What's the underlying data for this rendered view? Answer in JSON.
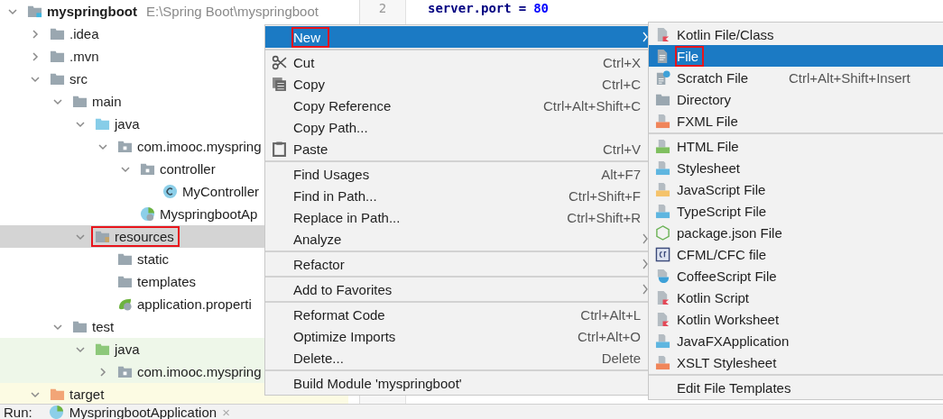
{
  "project_tree": [
    {
      "label": "myspringboot",
      "path": "E:\\Spring Boot\\myspringboot",
      "kind": "module",
      "expanded": true,
      "selected": false,
      "boxed": false,
      "children": [
        {
          "label": ".idea",
          "kind": "folder",
          "expanded": false,
          "selected": false,
          "boxed": false
        },
        {
          "label": ".mvn",
          "kind": "folder",
          "expanded": false,
          "selected": false,
          "boxed": false
        },
        {
          "label": "src",
          "kind": "folder",
          "expanded": true,
          "selected": false,
          "boxed": false,
          "children": [
            {
              "label": "main",
              "kind": "folder",
              "expanded": true,
              "selected": false,
              "boxed": false,
              "children": [
                {
                  "label": "java",
                  "kind": "source",
                  "expanded": true,
                  "selected": false,
                  "boxed": false,
                  "children": [
                    {
                      "label": "com.imooc.myspring",
                      "kind": "package",
                      "expanded": true,
                      "selected": false,
                      "boxed": false,
                      "children": [
                        {
                          "label": "controller",
                          "kind": "package",
                          "expanded": true,
                          "selected": false,
                          "boxed": false,
                          "children": [
                            {
                              "label": "MyController",
                              "kind": "class",
                              "selected": false,
                              "boxed": false
                            }
                          ]
                        },
                        {
                          "label": "MyspringbootAp",
                          "kind": "spring-class",
                          "selected": false,
                          "boxed": false
                        }
                      ]
                    }
                  ]
                },
                {
                  "label": "resources",
                  "kind": "resources",
                  "expanded": true,
                  "selected": true,
                  "boxed": true,
                  "children": [
                    {
                      "label": "static",
                      "kind": "folder",
                      "selected": false,
                      "boxed": false
                    },
                    {
                      "label": "templates",
                      "kind": "folder",
                      "selected": false,
                      "boxed": false
                    },
                    {
                      "label": "application.properti",
                      "kind": "spring-config",
                      "selected": false,
                      "boxed": false
                    }
                  ]
                }
              ]
            },
            {
              "label": "test",
              "kind": "folder",
              "expanded": true,
              "selected": false,
              "boxed": false,
              "children": [
                {
                  "label": "java",
                  "kind": "test-source",
                  "expanded": true,
                  "selected": false,
                  "boxed": false,
                  "color": "#eef7e9",
                  "children": [
                    {
                      "label": "com.imooc.myspring",
                      "kind": "package",
                      "expanded": false,
                      "selected": false,
                      "boxed": false,
                      "color": "#eef7e9"
                    }
                  ]
                }
              ]
            }
          ]
        },
        {
          "label": "target",
          "kind": "excluded",
          "expanded": true,
          "selected": false,
          "boxed": false,
          "color": "#fcfbe3"
        }
      ]
    }
  ],
  "editor": {
    "line_number": "2",
    "code": [
      {
        "kind": "key",
        "text": "server.port"
      },
      {
        "kind": "op",
        "text": "="
      },
      {
        "kind": "number",
        "text": "80"
      }
    ]
  },
  "run_bar": {
    "label": "Run:",
    "tab": "MyspringbootApplication",
    "close": "×"
  },
  "context_menu": [
    {
      "kind": "plain",
      "label": "New",
      "submenu": true,
      "selected": true,
      "boxed": true
    },
    {
      "kind": "separator"
    },
    {
      "kind": "cut",
      "label": "Cut",
      "shortcut": "Ctrl+X",
      "selected": false,
      "boxed": false
    },
    {
      "kind": "copy",
      "label": "Copy",
      "shortcut": "Ctrl+C",
      "selected": false,
      "boxed": false
    },
    {
      "kind": "plain",
      "label": "Copy Reference",
      "shortcut": "Ctrl+Alt+Shift+C",
      "selected": false,
      "boxed": false
    },
    {
      "kind": "plain",
      "label": "Copy Path...",
      "selected": false,
      "boxed": false
    },
    {
      "kind": "paste",
      "label": "Paste",
      "shortcut": "Ctrl+V",
      "selected": false,
      "boxed": false
    },
    {
      "kind": "separator"
    },
    {
      "kind": "plain",
      "label": "Find Usages",
      "shortcut": "Alt+F7",
      "selected": false,
      "boxed": false
    },
    {
      "kind": "plain",
      "label": "Find in Path...",
      "shortcut": "Ctrl+Shift+F",
      "selected": false,
      "boxed": false
    },
    {
      "kind": "plain",
      "label": "Replace in Path...",
      "shortcut": "Ctrl+Shift+R",
      "selected": false,
      "boxed": false
    },
    {
      "kind": "plain",
      "label": "Analyze",
      "submenu": true,
      "selected": false,
      "boxed": false
    },
    {
      "kind": "separator"
    },
    {
      "kind": "plain",
      "label": "Refactor",
      "submenu": true,
      "selected": false,
      "boxed": false
    },
    {
      "kind": "separator"
    },
    {
      "kind": "plain",
      "label": "Add to Favorites",
      "submenu": true,
      "selected": false,
      "boxed": false
    },
    {
      "kind": "separator"
    },
    {
      "kind": "plain",
      "label": "Reformat Code",
      "shortcut": "Ctrl+Alt+L",
      "selected": false,
      "boxed": false
    },
    {
      "kind": "plain",
      "label": "Optimize Imports",
      "shortcut": "Ctrl+Alt+O",
      "selected": false,
      "boxed": false
    },
    {
      "kind": "plain",
      "label": "Delete...",
      "shortcut": "Delete",
      "selected": false,
      "boxed": false
    },
    {
      "kind": "separator"
    },
    {
      "kind": "plain",
      "label": "Build Module 'myspringboot'",
      "selected": false,
      "boxed": false
    }
  ],
  "new_submenu": [
    {
      "kind": "kotlin",
      "label": "Kotlin File/Class",
      "selected": false,
      "boxed": false
    },
    {
      "kind": "file",
      "label": "File",
      "selected": true,
      "boxed": true
    },
    {
      "kind": "scratch",
      "label": "Scratch File",
      "shortcut": "Ctrl+Alt+Shift+Insert",
      "selected": false,
      "boxed": false
    },
    {
      "kind": "directory",
      "label": "Directory",
      "selected": false,
      "boxed": false
    },
    {
      "kind": "fxml",
      "label": "FXML File",
      "selected": false,
      "boxed": false
    },
    {
      "kind": "separator"
    },
    {
      "kind": "html",
      "label": "HTML File",
      "selected": false,
      "boxed": false
    },
    {
      "kind": "css",
      "label": "Stylesheet",
      "selected": false,
      "boxed": false
    },
    {
      "kind": "js",
      "label": "JavaScript File",
      "selected": false,
      "boxed": false
    },
    {
      "kind": "ts",
      "label": "TypeScript File",
      "selected": false,
      "boxed": false
    },
    {
      "kind": "npm",
      "label": "package.json File",
      "selected": false,
      "boxed": false
    },
    {
      "kind": "cfml",
      "label": "CFML/CFC file",
      "selected": false,
      "boxed": false
    },
    {
      "kind": "coffee",
      "label": "CoffeeScript File",
      "selected": false,
      "boxed": false
    },
    {
      "kind": "kotlin-script",
      "label": "Kotlin Script",
      "selected": false,
      "boxed": false
    },
    {
      "kind": "kotlin-script",
      "label": "Kotlin Worksheet",
      "selected": false,
      "boxed": false
    },
    {
      "kind": "javafx",
      "label": "JavaFXApplication",
      "selected": false,
      "boxed": false
    },
    {
      "kind": "xslt",
      "label": "XSLT Stylesheet",
      "selected": false,
      "boxed": false
    },
    {
      "kind": "separator"
    },
    {
      "kind": "plain",
      "label": "Edit File Templates",
      "selected": false,
      "boxed": false
    }
  ]
}
